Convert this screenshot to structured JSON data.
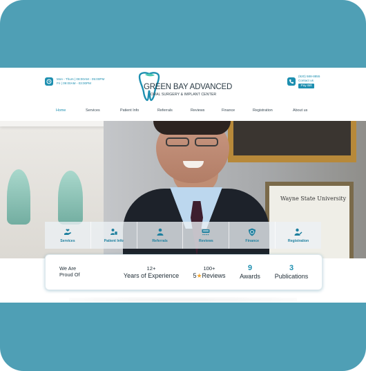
{
  "header": {
    "hours_line1": "Mon - Thurs | 08:00AM - 05:00PM",
    "hours_line2": "Fri | 09:00AM - 03:00PM",
    "logo_name": "GREEN BAY ADVANCED",
    "logo_sub": "ORAL SURGERY & IMPLANT CENTER",
    "phone": "(920) 588-8855",
    "contact_label": "Contact us",
    "pay_label": "Pay Bill"
  },
  "nav": [
    {
      "label": "Home",
      "active": true
    },
    {
      "label": "Services"
    },
    {
      "label": "Patient Info"
    },
    {
      "label": "Referrals"
    },
    {
      "label": "Reviews"
    },
    {
      "label": "Finance"
    },
    {
      "label": "Registration"
    },
    {
      "label": "About us"
    }
  ],
  "hero": {
    "certificate_title": "Wayne State University"
  },
  "services": [
    {
      "label": "Services",
      "icon": "hand-heart-icon"
    },
    {
      "label": "Patient Info",
      "icon": "patient-info-icon"
    },
    {
      "label": "Referrals",
      "icon": "doctor-icon"
    },
    {
      "label": "Reviews",
      "icon": "reviews-icon"
    },
    {
      "label": "Finance",
      "icon": "dollar-shield-icon"
    },
    {
      "label": "Registration",
      "icon": "registration-icon"
    }
  ],
  "stats": {
    "proud_line1": "We Are",
    "proud_line2": "Proud Of",
    "experience_num": "12+",
    "experience_label": "Years of Experience",
    "reviews_num": "100+",
    "reviews_prefix": "5",
    "reviews_label": "Reviews",
    "awards_num": "9",
    "awards_label": "Awards",
    "publications_num": "3",
    "publications_label": "Publications"
  },
  "colors": {
    "accent": "#1d8fb0",
    "frame_background": "#4f9fb5",
    "star": "#f2a632"
  }
}
